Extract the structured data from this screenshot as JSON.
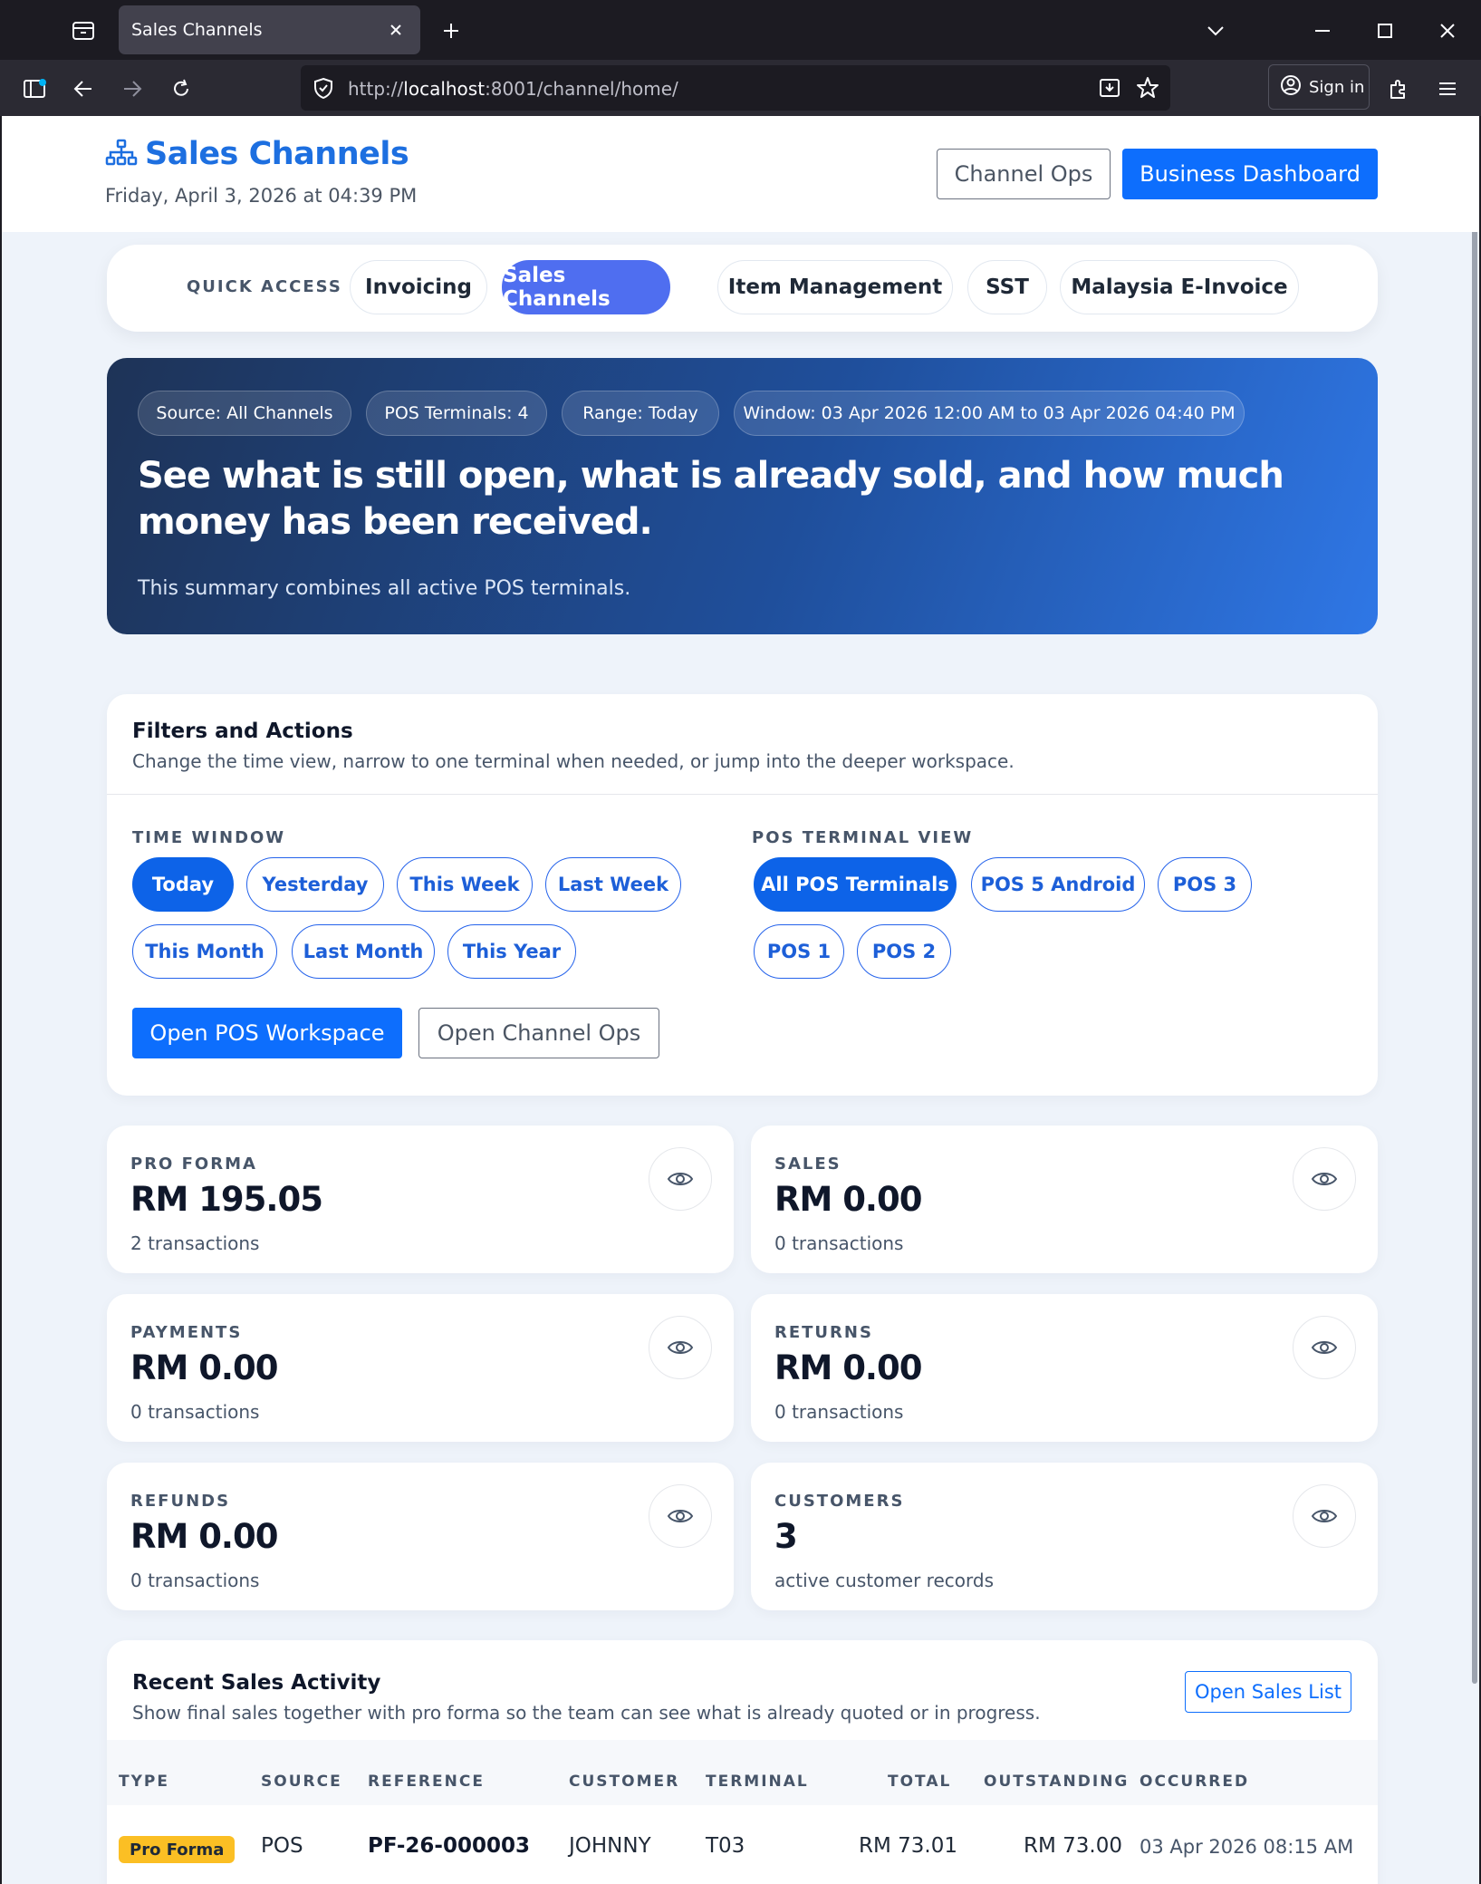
{
  "browser": {
    "tab_title": "Sales Channels",
    "url_prefix": "http://",
    "url_host": "localhost",
    "url_rest": ":8001/channel/home/",
    "signin_label": "Sign in"
  },
  "header": {
    "title": "Sales Channels",
    "date": "Friday, April 3, 2026 at 04:39 PM",
    "channel_ops_label": "Channel Ops",
    "business_dashboard_label": "Business Dashboard"
  },
  "quick_access": {
    "label": "QUICK ACCESS",
    "items": [
      {
        "label": "Invoicing"
      },
      {
        "label": "Sales Channels"
      },
      {
        "label": "Item Management"
      },
      {
        "label": "SST"
      },
      {
        "label": "Malaysia E-Invoice"
      }
    ]
  },
  "hero": {
    "chips": [
      {
        "label": "Source: All Channels"
      },
      {
        "label": "POS Terminals: 4"
      },
      {
        "label": "Range: Today"
      },
      {
        "label": "Window: 03 Apr 2026 12:00 AM to 03 Apr 2026 04:40 PM"
      }
    ],
    "title": "See what is still open, what is already sold, and how much money has been received.",
    "subtitle": "This summary combines all active POS terminals."
  },
  "filters": {
    "title": "Filters and Actions",
    "subtitle": "Change the time view, narrow to one terminal when needed, or jump into the deeper workspace.",
    "time_label": "TIME WINDOW",
    "time_options": [
      {
        "label": "Today"
      },
      {
        "label": "Yesterday"
      },
      {
        "label": "This Week"
      },
      {
        "label": "Last Week"
      },
      {
        "label": "This Month"
      },
      {
        "label": "Last Month"
      },
      {
        "label": "This Year"
      }
    ],
    "terminal_label": "POS TERMINAL VIEW",
    "terminal_options": [
      {
        "label": "All POS Terminals"
      },
      {
        "label": "POS 5 Android"
      },
      {
        "label": "POS 3"
      },
      {
        "label": "POS 1"
      },
      {
        "label": "POS 2"
      }
    ],
    "open_pos_label": "Open POS Workspace",
    "open_channel_ops_label": "Open Channel Ops"
  },
  "metrics": [
    {
      "label": "PRO FORMA",
      "value": "RM 195.05",
      "sub": "2 transactions"
    },
    {
      "label": "SALES",
      "value": "RM 0.00",
      "sub": "0 transactions"
    },
    {
      "label": "PAYMENTS",
      "value": "RM 0.00",
      "sub": "0 transactions"
    },
    {
      "label": "RETURNS",
      "value": "RM 0.00",
      "sub": "0 transactions"
    },
    {
      "label": "REFUNDS",
      "value": "RM 0.00",
      "sub": "0 transactions"
    },
    {
      "label": "CUSTOMERS",
      "value": "3",
      "sub": "active customer records"
    }
  ],
  "recent": {
    "title": "Recent Sales Activity",
    "subtitle": "Show final sales together with pro forma so the team can see what is already quoted or in progress.",
    "open_list_label": "Open Sales List",
    "columns": [
      "TYPE",
      "SOURCE",
      "REFERENCE",
      "CUSTOMER",
      "TERMINAL",
      "TOTAL",
      "OUTSTANDING",
      "OCCURRED"
    ],
    "rows": [
      {
        "type": "Pro Forma",
        "source": "POS",
        "reference": "PF-26-000003",
        "customer": "JOHNNY",
        "terminal": "T03",
        "total": "RM 73.01",
        "outstanding": "RM 73.00",
        "occurred": "03 Apr 2026 08:15 AM"
      }
    ]
  },
  "colors": {
    "brand": "#1d6fe0",
    "primary": "#0d6efd",
    "quick_active": "#4f6ef0",
    "badge": "#fbbf24"
  }
}
